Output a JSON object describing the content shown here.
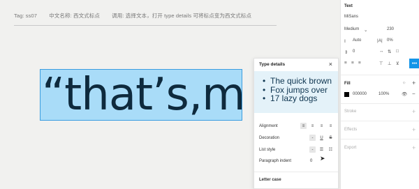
{
  "caption": {
    "tag": "Tag: ss07",
    "cn_name": "中文名称: 西文式标点",
    "usage": "调用: 选择文本，打开 type details 可将标点变为西文式标点"
  },
  "canvas": {
    "text": "“that’s,me"
  },
  "type_details": {
    "title": "Type details",
    "close": "×",
    "preview_items": [
      "The quick brown",
      "Fox jumps over",
      "17 lazy dogs"
    ],
    "alignment_label": "Alignment",
    "decoration_label": "Decoration",
    "decoration_none": "-",
    "list_style_label": "List style",
    "list_style_none": "-",
    "paragraph_indent_label": "Paragraph indent",
    "paragraph_indent_value": "0",
    "letter_case_label": "Letter case"
  },
  "panel": {
    "text_title": "Text",
    "font_name": "MiSans",
    "weight": "Medium",
    "size": "230",
    "line_height": "Auto",
    "letter_spacing": "0%",
    "paragraph_spacing": "0",
    "fill_title": "Fill",
    "fill_hex": "000000",
    "fill_opacity": "100%",
    "stroke_title": "Stroke",
    "effects_title": "Effects",
    "export_title": "Export",
    "more_icon": "•••",
    "fill_color": "#000000"
  }
}
